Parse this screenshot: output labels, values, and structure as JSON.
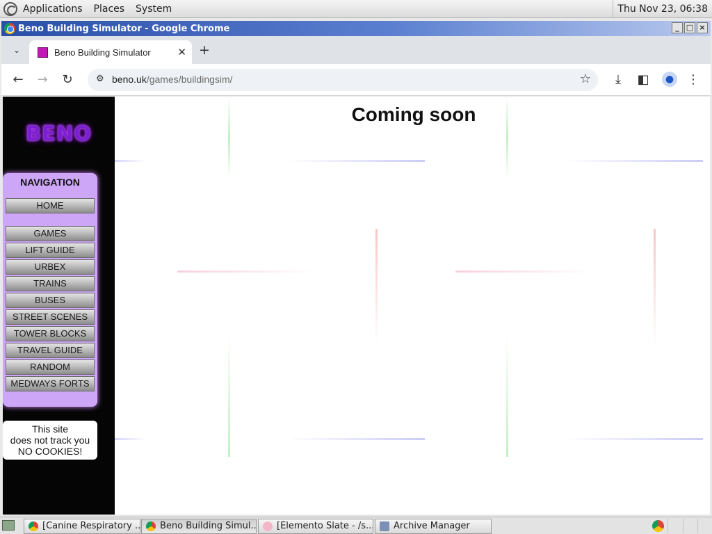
{
  "top_panel": {
    "menus": [
      "Applications",
      "Places",
      "System"
    ],
    "clock": "Thu Nov 23, 06:38"
  },
  "window": {
    "title": "Beno Building Simulator - Google Chrome"
  },
  "browser": {
    "tab_title": "Beno Building Simulator",
    "url_host": "beno.uk",
    "url_path": "/games/buildingsim/"
  },
  "site": {
    "logo": "BENO",
    "nav_title": "NAVIGATION",
    "nav_items": [
      "HOME",
      "GAMES",
      "LIFT GUIDE",
      "URBEX",
      "TRAINS",
      "BUSES",
      "STREET SCENES",
      "TOWER BLOCKS",
      "TRAVEL GUIDE",
      "RANDOM",
      "MEDWAYS FORTS"
    ],
    "cookie_notice": [
      "This site",
      "does not track you",
      "NO COOKIES!"
    ],
    "heading": "Coming soon"
  },
  "taskbar": {
    "tasks": [
      "[Canine Respiratory ...",
      "Beno Building Simul...",
      "[Elemento Slate - /s...",
      "Archive Manager"
    ]
  }
}
